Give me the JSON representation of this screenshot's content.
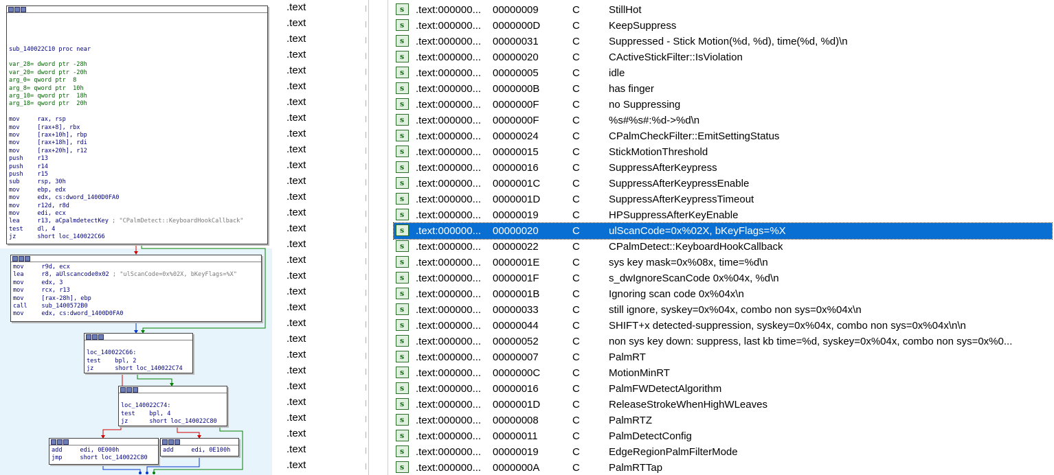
{
  "graph": {
    "node1": {
      "lines": [
        "",
        "",
        "",
        "",
        "sub_140022C10 proc near",
        "",
        {
          "t": "var_28= dword ptr -28h",
          "c": "var"
        },
        {
          "t": "var_20= dword ptr -20h",
          "c": "var"
        },
        {
          "t": "arg_0= qword ptr  8",
          "c": "var"
        },
        {
          "t": "arg_8= qword ptr  10h",
          "c": "var"
        },
        {
          "t": "arg_10= qword ptr  18h",
          "c": "var"
        },
        {
          "t": "arg_18= qword ptr  20h",
          "c": "var"
        },
        "",
        "mov     rax, rsp",
        "mov     [rax+8], rbx",
        "mov     [rax+10h], rbp",
        "mov     [rax+18h], rdi",
        "mov     [rax+20h], r12",
        "push    r13",
        "push    r14",
        "push    r15",
        "sub     rsp, 30h",
        "mov     ebp, edx",
        "mov     edx, cs:dword_1400D0FA0",
        "mov     r12d, r8d",
        "mov     edi, ecx",
        {
          "t": "lea     r13, aCpalmdetectKey",
          "cmt": " ; \"CPalmDetect::KeyboardHookCallback\""
        },
        "test    dl, 4",
        "jz      short loc_140022C66"
      ]
    },
    "node2": {
      "lines": [
        "mov     r9d, ecx",
        {
          "t": "lea     r8, aUlscancode0x02",
          "cmt": " ; \"ulScanCode=0x%02X, bKeyFlags=%X\""
        },
        "mov     edx, 3",
        "mov     rcx, r13",
        "mov     [rax-28h], ebp",
        "call    sub_1400572B0",
        "mov     edx, cs:dword_1400D0FA0"
      ]
    },
    "node3": {
      "lines": [
        "",
        "loc_140022C66:",
        "test    bpl, 2",
        "jz      short loc_140022C74"
      ]
    },
    "node4": {
      "lines": [
        "",
        "loc_140022C74:",
        "test    bpl, 4",
        "jz      short loc_140022C80"
      ]
    },
    "node5": {
      "lines": [
        "add     edi, 0E000h",
        "jmp     short loc_140022C80"
      ]
    },
    "node6": {
      "lines": [
        "add     edi, 0E100h"
      ]
    }
  },
  "segments": [
    ".text",
    ".text",
    ".text",
    ".text",
    ".text",
    ".text",
    ".text",
    ".text",
    ".text",
    ".text",
    ".text",
    ".text",
    ".text",
    ".text",
    ".text",
    ".text",
    ".text",
    ".text",
    ".text",
    ".text",
    ".text",
    ".text",
    ".text",
    ".text",
    ".text",
    ".text",
    ".text",
    ".text",
    ".text",
    ".text"
  ],
  "strings": {
    "icon_letter": "s",
    "selected_index": 14,
    "rows": [
      {
        "addr": ".text:000000...",
        "len": "00000009",
        "type": "C",
        "str": "StillHot"
      },
      {
        "addr": ".text:000000...",
        "len": "0000000D",
        "type": "C",
        "str": "KeepSuppress"
      },
      {
        "addr": ".text:000000...",
        "len": "00000031",
        "type": "C",
        "str": "Suppressed - Stick Motion(%d, %d), time(%d, %d)\\n"
      },
      {
        "addr": ".text:000000...",
        "len": "00000020",
        "type": "C",
        "str": "CActiveStickFilter::IsViolation"
      },
      {
        "addr": ".text:000000...",
        "len": "00000005",
        "type": "C",
        "str": "idle"
      },
      {
        "addr": ".text:000000...",
        "len": "0000000B",
        "type": "C",
        "str": "has finger"
      },
      {
        "addr": ".text:000000...",
        "len": "0000000F",
        "type": "C",
        "str": "no Suppressing"
      },
      {
        "addr": ".text:000000...",
        "len": "0000000F",
        "type": "C",
        "str": "%s#%s#:%d->%d\\n"
      },
      {
        "addr": ".text:000000...",
        "len": "00000024",
        "type": "C",
        "str": "CPalmCheckFilter::EmitSettingStatus"
      },
      {
        "addr": ".text:000000...",
        "len": "00000015",
        "type": "C",
        "str": "StickMotionThreshold"
      },
      {
        "addr": ".text:000000...",
        "len": "00000016",
        "type": "C",
        "str": "SuppressAfterKeypress"
      },
      {
        "addr": ".text:000000...",
        "len": "0000001C",
        "type": "C",
        "str": "SuppressAfterKeypressEnable"
      },
      {
        "addr": ".text:000000...",
        "len": "0000001D",
        "type": "C",
        "str": "SuppressAfterKeypressTimeout"
      },
      {
        "addr": ".text:000000...",
        "len": "00000019",
        "type": "C",
        "str": "HPSuppressAfterKeyEnable"
      },
      {
        "addr": ".text:000000...",
        "len": "00000020",
        "type": "C",
        "str": "ulScanCode=0x%02X, bKeyFlags=%X"
      },
      {
        "addr": ".text:000000...",
        "len": "00000022",
        "type": "C",
        "str": "CPalmDetect::KeyboardHookCallback"
      },
      {
        "addr": ".text:000000...",
        "len": "0000001E",
        "type": "C",
        "str": "sys key mask=0x%08x, time=%d\\n"
      },
      {
        "addr": ".text:000000...",
        "len": "0000001F",
        "type": "C",
        "str": "s_dwIgnoreScanCode 0x%04x, %d\\n"
      },
      {
        "addr": ".text:000000...",
        "len": "0000001B",
        "type": "C",
        "str": "Ignoring scan code 0x%04x\\n"
      },
      {
        "addr": ".text:000000...",
        "len": "00000033",
        "type": "C",
        "str": "still ignore, syskey=0x%04x, combo non sys=0x%04x\\n"
      },
      {
        "addr": ".text:000000...",
        "len": "00000044",
        "type": "C",
        "str": "SHIFT+x detected-suppression, syskey=0x%04x, combo non sys=0x%04x\\n\\n"
      },
      {
        "addr": ".text:000000...",
        "len": "00000052",
        "type": "C",
        "str": "non sys key down: suppress, last kb time=%d, syskey=0x%04x, combo non sys=0x%0..."
      },
      {
        "addr": ".text:000000...",
        "len": "00000007",
        "type": "C",
        "str": "PalmRT"
      },
      {
        "addr": ".text:000000...",
        "len": "0000000C",
        "type": "C",
        "str": "MotionMinRT"
      },
      {
        "addr": ".text:000000...",
        "len": "00000016",
        "type": "C",
        "str": "PalmFWDetectAlgorithm"
      },
      {
        "addr": ".text:000000...",
        "len": "0000001D",
        "type": "C",
        "str": "ReleaseStrokeWhenHighWLeaves"
      },
      {
        "addr": ".text:000000...",
        "len": "00000008",
        "type": "C",
        "str": "PalmRTZ"
      },
      {
        "addr": ".text:000000...",
        "len": "00000011",
        "type": "C",
        "str": "PalmDetectConfig"
      },
      {
        "addr": ".text:000000...",
        "len": "00000019",
        "type": "C",
        "str": "EdgeRegionPalmFilterMode"
      },
      {
        "addr": ".text:000000...",
        "len": "0000000A",
        "type": "C",
        "str": "PalmRTTap"
      }
    ]
  },
  "colors": {
    "selection": "#0a6fd2",
    "asm_text": "#000080",
    "asm_var": "#006400",
    "graph_background": "#e8f4fb",
    "edge_true": "#008000",
    "edge_false": "#d00000",
    "edge_uncond": "#0033cc"
  }
}
